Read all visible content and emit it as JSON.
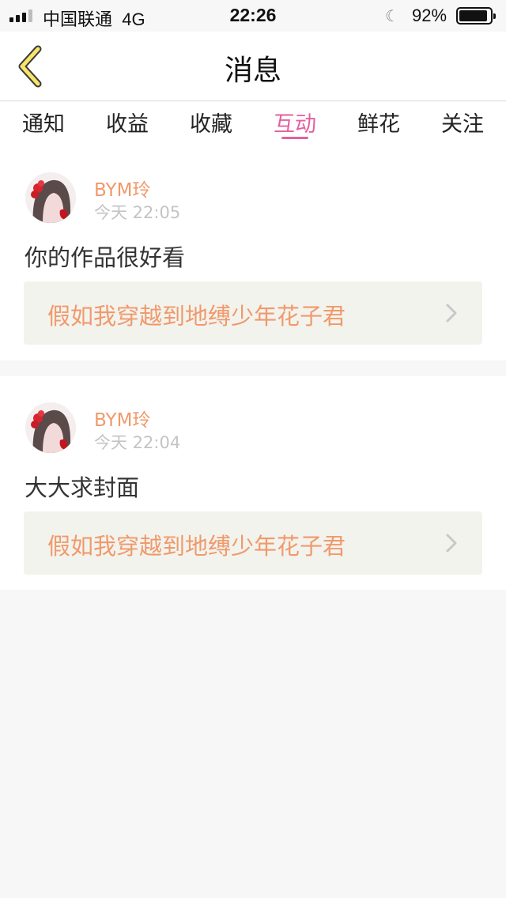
{
  "status_bar": {
    "carrier": "中国联通",
    "network": "4G",
    "time": "22:26",
    "battery": "92%"
  },
  "header": {
    "title": "消息"
  },
  "tabs": [
    {
      "label": "通知",
      "active": false
    },
    {
      "label": "收益",
      "active": false
    },
    {
      "label": "收藏",
      "active": false
    },
    {
      "label": "互动",
      "active": true
    },
    {
      "label": "鲜花",
      "active": false
    },
    {
      "label": "关注",
      "active": false
    }
  ],
  "messages": [
    {
      "username": "BYM玲",
      "timestamp": "今天 22:05",
      "text": "你的作品很好看",
      "work_title": "假如我穿越到地缚少年花子君"
    },
    {
      "username": "BYM玲",
      "timestamp": "今天 22:04",
      "text": "大大求封面",
      "work_title": "假如我穿越到地缚少年花子君"
    }
  ],
  "colors": {
    "accent": "#e55fa0",
    "username": "#f09a6b",
    "back_icon": "#f7e46a"
  }
}
